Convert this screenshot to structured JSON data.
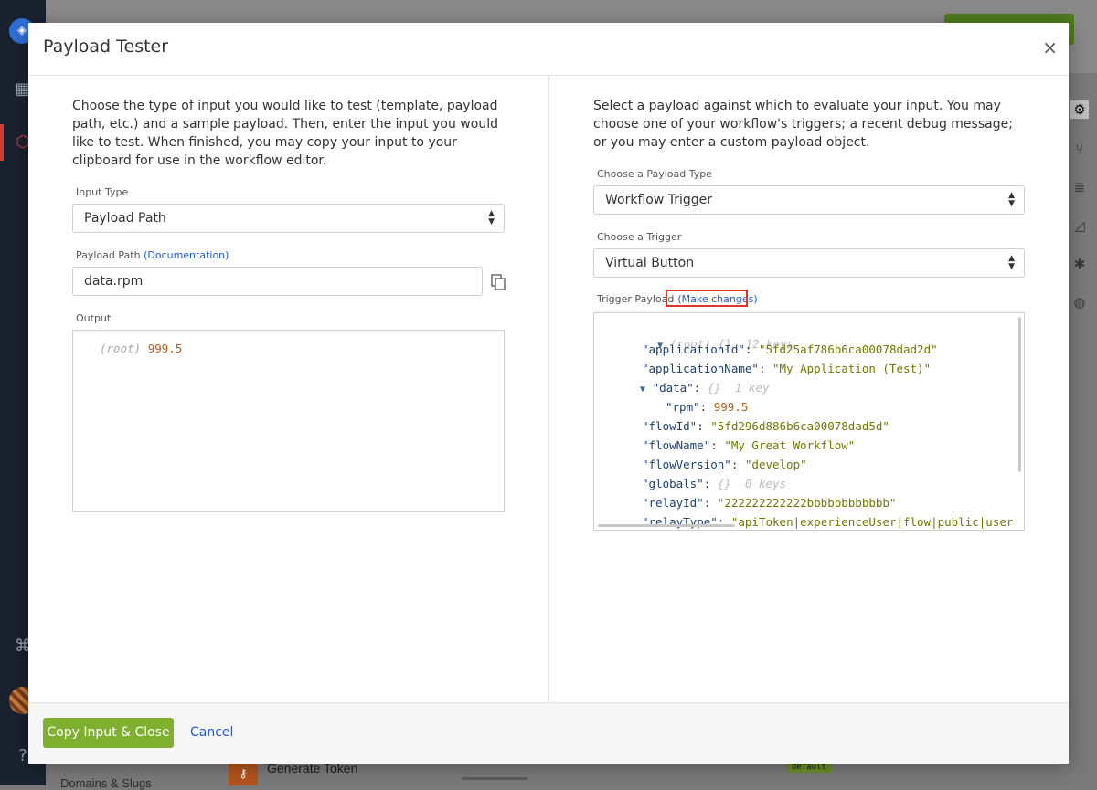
{
  "background": {
    "sidebar_icons": [
      "app-logo-icon",
      "dashboard-icon",
      "applications-icon",
      "workflows-icon",
      "help-icon"
    ],
    "token_label": "Generate Token",
    "default_badge": "default",
    "domains_label": "Domains & Slugs"
  },
  "modal": {
    "title": "Payload Tester",
    "close": "×",
    "left": {
      "description": "Choose the type of input you would like to test (template, payload path, etc.) and a sample payload. Then, enter the input you would like to test. When finished, you may copy your input to your clipboard for use in the workflow editor.",
      "input_type_label": "Input Type",
      "input_type_value": "Payload Path",
      "payload_path_label": "Payload Path",
      "payload_path_doc_link": "(Documentation)",
      "payload_path_value": "data.rpm",
      "output_label": "Output",
      "output_root": "(root)",
      "output_value": "999.5"
    },
    "right": {
      "description": "Select a payload against which to evaluate your input. You may choose one of your workflow's triggers; a recent debug message; or you may enter a custom payload object.",
      "payload_type_label": "Choose a Payload Type",
      "payload_type_value": "Workflow Trigger",
      "trigger_label": "Choose a Trigger",
      "trigger_value": "Virtual Button",
      "trigger_payload_label": "Trigger Payload",
      "make_changes_link": "(Make changes)",
      "json_tree": {
        "root_label": "(root)",
        "root_meta": "{}  12 keys",
        "applicationId": "\"5fd25af786b6ca00078dad2d\"",
        "applicationName": "\"My Application (Test)\"",
        "data_meta": "{}  1 key",
        "rpm": "999.5",
        "flowId": "\"5fd296d886b6ca00078dad5d\"",
        "flowName": "\"My Great Workflow\"",
        "flowVersion": "\"develop\"",
        "globals_meta": "{}  0 keys",
        "relayId": "\"222222222222bbbbbbbbbbbb\"",
        "relayType": "\"apiToken|experienceUser|flow|public|user"
      }
    },
    "footer": {
      "primary_button": "Copy Input & Close",
      "cancel_button": "Cancel"
    }
  },
  "colors": {
    "primary_button": "#7fb02f",
    "link": "#1c5ad6",
    "highlight_box": "#e0342a"
  }
}
